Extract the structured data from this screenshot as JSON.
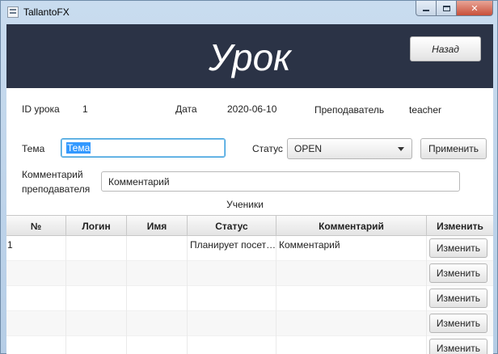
{
  "window": {
    "title": "TallantoFX",
    "controls": {
      "minimize": "–",
      "maximize": "□",
      "close": "✕"
    }
  },
  "header": {
    "title": "Урок",
    "back_label": "Назад"
  },
  "lesson": {
    "id_label": "ID урока",
    "id_value": "1",
    "date_label": "Дата",
    "date_value": "2020-06-10",
    "teacher_label": "Преподаватель",
    "teacher_value": "teacher",
    "topic_label": "Тема",
    "topic_value": "Тема",
    "status_label": "Статус",
    "status_value": "OPEN",
    "apply_label": "Применить",
    "comment_label_line1": "Комментарий",
    "comment_label_line2": "преподавателя",
    "comment_value": "Комментарий"
  },
  "students": {
    "caption": "Ученики",
    "columns": [
      "№",
      "Логин",
      "Имя",
      "Статус",
      "Комментарий",
      "Изменить"
    ],
    "rows": [
      {
        "num": "1",
        "login": "",
        "name": "",
        "status": "Планирует посет…",
        "comment": "Комментарий",
        "action": "Изменить"
      },
      {
        "num": "",
        "login": "",
        "name": "",
        "status": "",
        "comment": "",
        "action": "Изменить"
      },
      {
        "num": "",
        "login": "",
        "name": "",
        "status": "",
        "comment": "",
        "action": "Изменить"
      },
      {
        "num": "",
        "login": "",
        "name": "",
        "status": "",
        "comment": "",
        "action": "Изменить"
      },
      {
        "num": "",
        "login": "",
        "name": "",
        "status": "",
        "comment": "",
        "action": "Изменить"
      }
    ]
  },
  "colors": {
    "header_bg": "#2b3346",
    "focus_border": "#3c9fdc",
    "selection": "#3399ff",
    "close_button": "#c8503a"
  }
}
